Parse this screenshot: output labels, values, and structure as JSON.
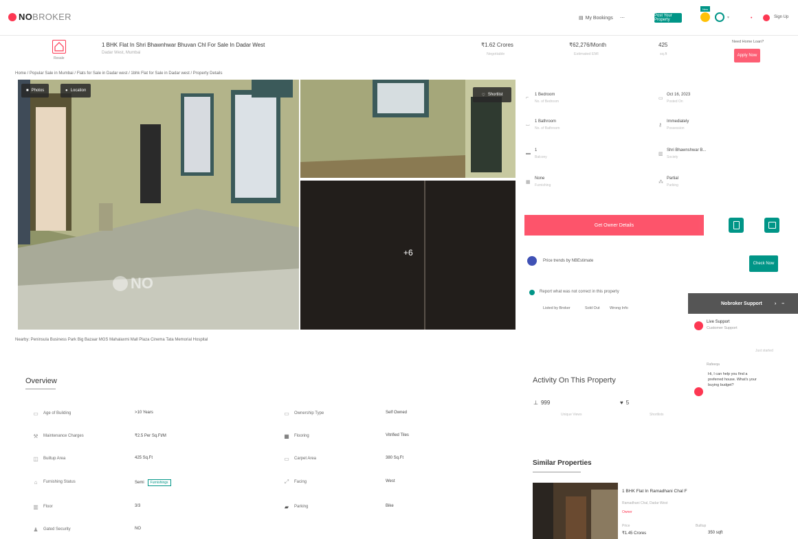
{
  "header": {
    "logo_strong": "NO",
    "logo_rest": "BROKER",
    "my_bookings": "My Bookings",
    "post_property_btn": "Post Your Property",
    "new_badge": "New",
    "menu_label": "Menu",
    "sign_in": "Sign Up"
  },
  "property": {
    "title": "1 BHK Flat In Shri Bhawnhwar Bhuvan Chl For Sale In Dadar West",
    "subtitle": "Dadar West, Mumbai",
    "type_label": "Resale",
    "price": "₹1.62 Crores",
    "price_label": "Negotiable",
    "emi": "₹62,276/Month",
    "emi_label": "Estimated EMI",
    "area": "425",
    "area_label": "sq.ft",
    "loan_text": "Need Home Loan?",
    "apply_btn": "Apply Now"
  },
  "breadcrumb": "Home / Popular Sale in Mumbai / Flats for Sale in Dadar west / 1bhk Flat for Sale in Dadar west / Property Details",
  "photos": {
    "photos_btn": "Photos",
    "location_btn": "Location",
    "shortlist_btn": "Shortlist",
    "more_count": "+6",
    "watermark": "NO"
  },
  "nearby": "Nearby:   Peninsula Business Park    Big Bazaar    MGS Mahalaxmi Mall    Plaza Cinema    Tata Memorial Hospital",
  "details": {
    "bedroom": "1 Bedroom",
    "bedroom_sub": "No. of Bedroom",
    "bathroom": "1 Bathroom",
    "bathroom_sub": "No. of Bathroom",
    "balcony": "1",
    "balcony_sub": "Balcony",
    "furnishing": "None",
    "furnishing_sub": "Furnishing",
    "posted_on": "Oct 16, 2023",
    "posted_sub": "Posted On",
    "possession": "Immediately",
    "possession_sub": "Possession",
    "society": "Shri Bhawnshwar B...",
    "society_sub": "Society",
    "parking": "Partial",
    "parking_sub": "Parking"
  },
  "contact_btn": "Get Owner Details",
  "price_trends": "Price trends by NBEstimate",
  "check_now": "Check Now",
  "report": {
    "text": "Report what was not correct in this property",
    "opt1": "Listed by Broker",
    "opt2": "Sold Out",
    "opt3": "Wrong Info"
  },
  "support": {
    "title": "Nobroker Support",
    "live_title": "Live Support",
    "live_sub": "Customer Support",
    "just_now": "Just started",
    "agent": "Rafeeqa",
    "message": "Hi, I can help you find a preferred house. What's your buying budget?"
  },
  "activity": {
    "title": "Activity On This Property",
    "views": "999",
    "views_label": "Unique Views",
    "shortlists": "5",
    "shortlists_label": "Shortlists"
  },
  "similar": {
    "title": "Similar Properties",
    "item_title": "1 BHK Flat In Ramadhani Chal F",
    "item_sub": "Ramadhani Chal, Dadar West",
    "item_badge": "Owner",
    "item_price": "₹1.45 Crores",
    "item_price_label": "Price",
    "item_area": "350 sqft",
    "item_area_label": "Builtup"
  },
  "overview": {
    "title": "Overview",
    "left": [
      {
        "label": "Age of Building",
        "value": ">10 Years"
      },
      {
        "label": "Maintenance Charges",
        "value": "₹2.5 Per Sq.Ft/M"
      },
      {
        "label": "Builtup Area",
        "value": "425 Sq.Ft"
      },
      {
        "label": "Furnishing Status",
        "value": "Semi"
      },
      {
        "label": "Floor",
        "value": "3/3"
      },
      {
        "label": "Gated Security",
        "value": "NO"
      }
    ],
    "right": [
      {
        "label": "Ownership Type",
        "value": "Self Owned"
      },
      {
        "label": "Flooring",
        "value": "Vitrified Tiles"
      },
      {
        "label": "Carpet Area",
        "value": "380 Sq.Ft"
      },
      {
        "label": "Facing",
        "value": "West"
      },
      {
        "label": "Parking",
        "value": "Bike"
      }
    ],
    "furnishing_link": "Furnishings"
  },
  "colors": {
    "brand_red": "#fd3752",
    "brand_green": "#009587"
  }
}
